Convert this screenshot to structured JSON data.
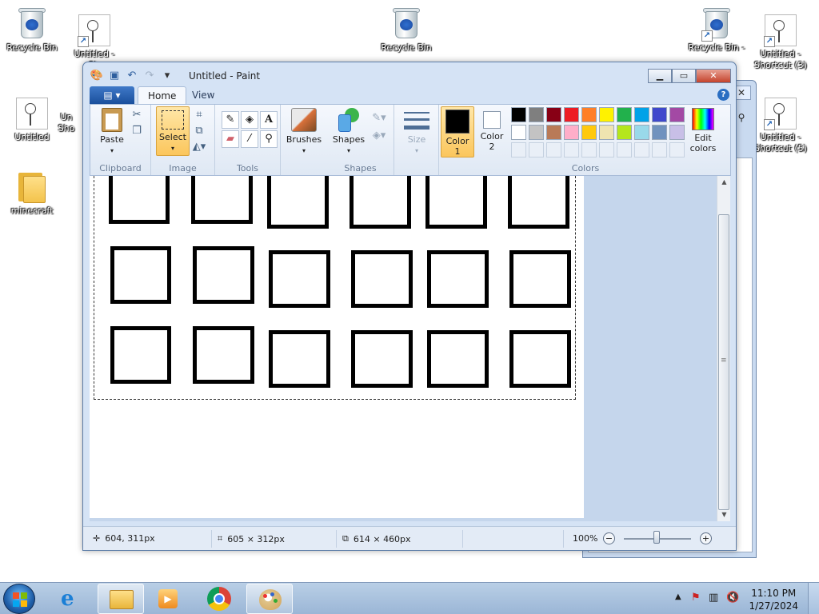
{
  "desktop": {
    "icons": [
      {
        "label": "Recycle Bin",
        "kind": "recycle-bin"
      },
      {
        "label": "Untitled -\nSh",
        "kind": "paint-shortcut"
      },
      {
        "label": "Recycle Bin",
        "kind": "recycle-bin"
      },
      {
        "label": "Recycle Bin -",
        "kind": "recycle-bin-shortcut"
      },
      {
        "label": "Untitled -\nShortcut (3)",
        "kind": "paint-shortcut"
      },
      {
        "label": "Untitled",
        "kind": "paint-file"
      },
      {
        "label": "Un\nSho",
        "kind": "paint-shortcut"
      },
      {
        "label": "Untitled -\nShortcut (5)",
        "kind": "paint-shortcut"
      },
      {
        "label": "minecraft",
        "kind": "folder"
      }
    ]
  },
  "paint": {
    "title": "Untitled - Paint",
    "tabs": {
      "file": "▤ ▾",
      "home": "Home",
      "view": "View"
    },
    "clipboard": {
      "paste": "Paste",
      "group": "Clipboard"
    },
    "image": {
      "select": "Select",
      "group": "Image"
    },
    "tools": {
      "group": "Tools"
    },
    "brushes": {
      "label": "Brushes"
    },
    "shapes": {
      "label": "Shapes",
      "group": "Shapes"
    },
    "size": {
      "label": "Size"
    },
    "colors": {
      "color1": "Color",
      "color1_num": "1",
      "color2": "Color",
      "color2_num": "2",
      "edit": "Edit",
      "edit2": "colors",
      "group": "Colors",
      "color1_value": "#000000",
      "color2_value": "#ffffff",
      "palette_row1": [
        "#000000",
        "#7f7f7f",
        "#880015",
        "#ed1c24",
        "#ff7f27",
        "#fff200",
        "#22b14c",
        "#00a2e8",
        "#3f48cc",
        "#a349a4"
      ],
      "palette_row2": [
        "#ffffff",
        "#c3c3c3",
        "#b97a57",
        "#ffaec9",
        "#ffc90e",
        "#efe4b0",
        "#b5e61d",
        "#99d9ea",
        "#7092be",
        "#c8bfe7"
      ]
    },
    "status": {
      "cursor": "604, 311px",
      "selection_size": "605 × 312px",
      "image_size": "614 × 460px",
      "zoom": "100%"
    }
  },
  "taskbar": {
    "time": "11:10 PM",
    "date": "1/27/2024"
  }
}
